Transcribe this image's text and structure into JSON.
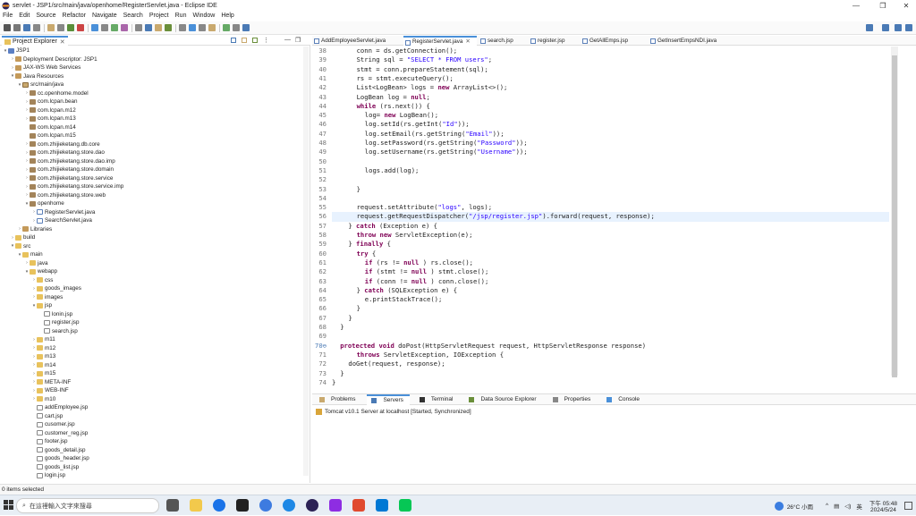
{
  "window": {
    "title": "servlet - JSP1/src/main/java/openhome/RegisterServlet.java - Eclipse IDE",
    "controls": [
      "—",
      "❐",
      "✕"
    ]
  },
  "menu": [
    "File",
    "Edit",
    "Source",
    "Refactor",
    "Navigate",
    "Search",
    "Project",
    "Run",
    "Window",
    "Help"
  ],
  "explorer": {
    "tab_label": "Project Explorer",
    "tree": [
      {
        "d": 0,
        "t": "▾",
        "icon": "proj",
        "label": "JSP1"
      },
      {
        "d": 1,
        "t": "›",
        "icon": "lib",
        "label": "Deployment Descriptor: JSP1"
      },
      {
        "d": 1,
        "t": "›",
        "icon": "lib",
        "label": "JAX-WS Web Services"
      },
      {
        "d": 1,
        "t": "▾",
        "icon": "lib",
        "label": "Java Resources"
      },
      {
        "d": 2,
        "t": "▾",
        "icon": "src",
        "label": "src/main/java"
      },
      {
        "d": 3,
        "t": "›",
        "icon": "pkg",
        "label": "cc.openhome.model"
      },
      {
        "d": 3,
        "t": "›",
        "icon": "pkg",
        "label": "com.lcpan.bean"
      },
      {
        "d": 3,
        "t": "›",
        "icon": "pkg",
        "label": "com.lcpan.m12"
      },
      {
        "d": 3,
        "t": "›",
        "icon": "pkg",
        "label": "com.lcpan.m13"
      },
      {
        "d": 3,
        "t": "",
        "icon": "pkg",
        "label": "com.lcpan.m14"
      },
      {
        "d": 3,
        "t": "",
        "icon": "pkg",
        "label": "com.lcpan.m15"
      },
      {
        "d": 3,
        "t": "›",
        "icon": "pkg",
        "label": "com.zhijieketang.db.core"
      },
      {
        "d": 3,
        "t": "›",
        "icon": "pkg",
        "label": "com.zhijieketang.store.dao"
      },
      {
        "d": 3,
        "t": "›",
        "icon": "pkg",
        "label": "com.zhijieketang.store.dao.imp"
      },
      {
        "d": 3,
        "t": "›",
        "icon": "pkg",
        "label": "com.zhijieketang.store.domain"
      },
      {
        "d": 3,
        "t": "›",
        "icon": "pkg",
        "label": "com.zhijieketang.store.service"
      },
      {
        "d": 3,
        "t": "›",
        "icon": "pkg",
        "label": "com.zhijieketang.store.service.imp"
      },
      {
        "d": 3,
        "t": "›",
        "icon": "pkg",
        "label": "com.zhijieketang.store.web"
      },
      {
        "d": 3,
        "t": "▾",
        "icon": "pkg",
        "label": "openhome"
      },
      {
        "d": 4,
        "t": "›",
        "icon": "java",
        "label": "RegisterServlet.java"
      },
      {
        "d": 4,
        "t": "›",
        "icon": "java",
        "label": "SearchServlet.java"
      },
      {
        "d": 2,
        "t": "›",
        "icon": "lib",
        "label": "Libraries"
      },
      {
        "d": 1,
        "t": "›",
        "icon": "folder",
        "label": "build"
      },
      {
        "d": 1,
        "t": "▾",
        "icon": "folder",
        "label": "src"
      },
      {
        "d": 2,
        "t": "▾",
        "icon": "folder",
        "label": "main"
      },
      {
        "d": 3,
        "t": "›",
        "icon": "folder",
        "label": "java"
      },
      {
        "d": 3,
        "t": "▾",
        "icon": "folder",
        "label": "webapp"
      },
      {
        "d": 4,
        "t": "›",
        "icon": "folder",
        "label": "css"
      },
      {
        "d": 4,
        "t": "›",
        "icon": "folder",
        "label": "goods_images"
      },
      {
        "d": 4,
        "t": "›",
        "icon": "folder",
        "label": "images"
      },
      {
        "d": 4,
        "t": "▾",
        "icon": "folder",
        "label": "jsp"
      },
      {
        "d": 5,
        "t": "",
        "icon": "jsp",
        "label": "lonin.jsp"
      },
      {
        "d": 5,
        "t": "",
        "icon": "jsp",
        "label": "register.jsp"
      },
      {
        "d": 5,
        "t": "",
        "icon": "jsp",
        "label": "search.jsp"
      },
      {
        "d": 4,
        "t": "›",
        "icon": "folder",
        "label": "m11"
      },
      {
        "d": 4,
        "t": "›",
        "icon": "folder",
        "label": "m12"
      },
      {
        "d": 4,
        "t": "›",
        "icon": "folder",
        "label": "m13"
      },
      {
        "d": 4,
        "t": "›",
        "icon": "folder",
        "label": "m14"
      },
      {
        "d": 4,
        "t": "›",
        "icon": "folder",
        "label": "m15"
      },
      {
        "d": 4,
        "t": "›",
        "icon": "folder",
        "label": "META-INF"
      },
      {
        "d": 4,
        "t": "›",
        "icon": "folder",
        "label": "WEB-INF"
      },
      {
        "d": 4,
        "t": "›",
        "icon": "folder",
        "label": "m10"
      },
      {
        "d": 4,
        "t": "",
        "icon": "jsp",
        "label": "addEmployee.jsp"
      },
      {
        "d": 4,
        "t": "",
        "icon": "jsp",
        "label": "cart.jsp"
      },
      {
        "d": 4,
        "t": "",
        "icon": "jsp",
        "label": "cusomer.jsp"
      },
      {
        "d": 4,
        "t": "",
        "icon": "jsp",
        "label": "customer_reg.jsp"
      },
      {
        "d": 4,
        "t": "",
        "icon": "jsp",
        "label": "footer.jsp"
      },
      {
        "d": 4,
        "t": "",
        "icon": "jsp",
        "label": "goods_detail.jsp"
      },
      {
        "d": 4,
        "t": "",
        "icon": "jsp",
        "label": "goods_header.jsp"
      },
      {
        "d": 4,
        "t": "",
        "icon": "jsp",
        "label": "goods_list.jsp"
      },
      {
        "d": 4,
        "t": "",
        "icon": "jsp",
        "label": "login.jsp"
      }
    ]
  },
  "status": "0 items selected",
  "editor_tabs": [
    {
      "label": "AddEmployeeServlet.java",
      "active": false
    },
    {
      "label": "RegisterServlet.java",
      "active": true
    },
    {
      "label": "search.jsp",
      "active": false
    },
    {
      "label": "register.jsp",
      "active": false
    },
    {
      "label": "GetAllEmps.jsp",
      "active": false
    },
    {
      "label": "GetInsertEmpsNDI.java",
      "active": false
    }
  ],
  "code": [
    {
      "n": "38",
      "i": 6,
      "s": [
        [
          "",
          "conn = ds.getConnection();"
        ]
      ]
    },
    {
      "n": "39",
      "i": 6,
      "s": [
        [
          "",
          "String sql = "
        ],
        [
          "str",
          "\"SELECT * FROM users\""
        ],
        [
          "",
          ";"
        ]
      ]
    },
    {
      "n": "40",
      "i": 6,
      "s": [
        [
          "",
          "stmt = conn.prepareStatement(sql);"
        ]
      ]
    },
    {
      "n": "41",
      "i": 6,
      "s": [
        [
          "",
          "rs = stmt.executeQuery();"
        ]
      ]
    },
    {
      "n": "42",
      "i": 6,
      "s": [
        [
          "",
          "List<LogBean> logs = "
        ],
        [
          "kw",
          "new"
        ],
        [
          "",
          " ArrayList<>();"
        ]
      ]
    },
    {
      "n": "43",
      "i": 6,
      "s": [
        [
          "",
          "LogBean log = "
        ],
        [
          "kw",
          "null"
        ],
        [
          "",
          ";"
        ]
      ]
    },
    {
      "n": "44",
      "i": 6,
      "s": [
        [
          "kw",
          "while"
        ],
        [
          "",
          " (rs.next()) {"
        ]
      ]
    },
    {
      "n": "45",
      "i": 8,
      "s": [
        [
          "",
          "log= "
        ],
        [
          "kw",
          "new"
        ],
        [
          "",
          " LogBean();"
        ]
      ]
    },
    {
      "n": "46",
      "i": 8,
      "s": [
        [
          "",
          "log.setId(rs.getInt("
        ],
        [
          "str",
          "\"Id\""
        ],
        [
          "",
          "));"
        ]
      ]
    },
    {
      "n": "47",
      "i": 8,
      "s": [
        [
          "",
          "log.setEmail(rs.getString("
        ],
        [
          "str",
          "\"Email\""
        ],
        [
          "",
          "));"
        ]
      ]
    },
    {
      "n": "48",
      "i": 8,
      "s": [
        [
          "",
          "log.setPassword(rs.getString("
        ],
        [
          "str",
          "\"Password\""
        ],
        [
          "",
          "));"
        ]
      ]
    },
    {
      "n": "49",
      "i": 8,
      "s": [
        [
          "",
          "log.setUsername(rs.getString("
        ],
        [
          "str",
          "\"Username\""
        ],
        [
          "",
          "));"
        ]
      ]
    },
    {
      "n": "50",
      "i": 0,
      "s": []
    },
    {
      "n": "51",
      "i": 8,
      "s": [
        [
          "",
          "logs.add(log);"
        ]
      ]
    },
    {
      "n": "52",
      "i": 0,
      "s": []
    },
    {
      "n": "53",
      "i": 6,
      "s": [
        [
          "",
          "}"
        ]
      ]
    },
    {
      "n": "54",
      "i": 0,
      "s": []
    },
    {
      "n": "55",
      "i": 6,
      "s": [
        [
          "",
          "request.setAttribute("
        ],
        [
          "str",
          "\"logs\""
        ],
        [
          "",
          ", logs);"
        ]
      ]
    },
    {
      "n": "56",
      "i": 6,
      "s": [
        [
          "",
          "request.getRequestDispatcher("
        ],
        [
          "str",
          "\"/jsp/register.jsp\""
        ],
        [
          "",
          ").forward(request, response);"
        ]
      ],
      "hl": true
    },
    {
      "n": "57",
      "i": 4,
      "s": [
        [
          "",
          "} "
        ],
        [
          "kw",
          "catch"
        ],
        [
          "",
          " (Exception e) {"
        ]
      ]
    },
    {
      "n": "58",
      "i": 6,
      "s": [
        [
          "kw",
          "throw new"
        ],
        [
          "",
          " ServletException(e);"
        ]
      ]
    },
    {
      "n": "59",
      "i": 4,
      "s": [
        [
          "",
          "} "
        ],
        [
          "kw",
          "finally"
        ],
        [
          "",
          " {"
        ]
      ]
    },
    {
      "n": "60",
      "i": 6,
      "s": [
        [
          "kw",
          "try"
        ],
        [
          "",
          " {"
        ]
      ]
    },
    {
      "n": "61",
      "i": 8,
      "s": [
        [
          "kw",
          "if"
        ],
        [
          "",
          " (rs != "
        ],
        [
          "kw",
          "null"
        ],
        [
          "",
          " ) rs.close();"
        ]
      ]
    },
    {
      "n": "62",
      "i": 8,
      "s": [
        [
          "kw",
          "if"
        ],
        [
          "",
          " (stmt != "
        ],
        [
          "kw",
          "null"
        ],
        [
          "",
          " ) stmt.close();"
        ]
      ]
    },
    {
      "n": "63",
      "i": 8,
      "s": [
        [
          "kw",
          "if"
        ],
        [
          "",
          " (conn != "
        ],
        [
          "kw",
          "null"
        ],
        [
          "",
          " ) conn.close();"
        ]
      ]
    },
    {
      "n": "64",
      "i": 6,
      "s": [
        [
          "",
          "} "
        ],
        [
          "kw",
          "catch"
        ],
        [
          "",
          " (SQLException e) {"
        ]
      ]
    },
    {
      "n": "65",
      "i": 8,
      "s": [
        [
          "",
          "e.printStackTrace();"
        ]
      ]
    },
    {
      "n": "66",
      "i": 6,
      "s": [
        [
          "",
          "}"
        ]
      ]
    },
    {
      "n": "67",
      "i": 4,
      "s": [
        [
          "",
          "}"
        ]
      ]
    },
    {
      "n": "68",
      "i": 2,
      "s": [
        [
          "",
          "}"
        ]
      ]
    },
    {
      "n": "69",
      "i": 0,
      "s": []
    },
    {
      "n": "70⊖",
      "i": 2,
      "s": [
        [
          "kw",
          "protected void"
        ],
        [
          "",
          " doPost(HttpServletRequest request, HttpServletResponse response)"
        ]
      ],
      "ann": true
    },
    {
      "n": "71",
      "i": 6,
      "s": [
        [
          "kw",
          "throws"
        ],
        [
          "",
          " ServletException, IOException {"
        ]
      ]
    },
    {
      "n": "72",
      "i": 4,
      "s": [
        [
          "",
          "doGet(request, response);"
        ]
      ]
    },
    {
      "n": "73",
      "i": 2,
      "s": [
        [
          "",
          "}"
        ]
      ]
    },
    {
      "n": "74",
      "i": 0,
      "s": [
        [
          "",
          "}"
        ]
      ]
    }
  ],
  "bottom": {
    "tabs": [
      "Problems",
      "Servers",
      "Terminal",
      "Data Source Explorer",
      "Properties",
      "Console"
    ],
    "server": "Tomcat v10.1 Server at localhost  [Started, Synchronized]"
  },
  "taskbar": {
    "search_placeholder": "在這裡輸入文字來搜尋",
    "weather": "26°C 小雨",
    "time": "下午 05:48",
    "date": "2024/5/24",
    "lang": "英"
  }
}
